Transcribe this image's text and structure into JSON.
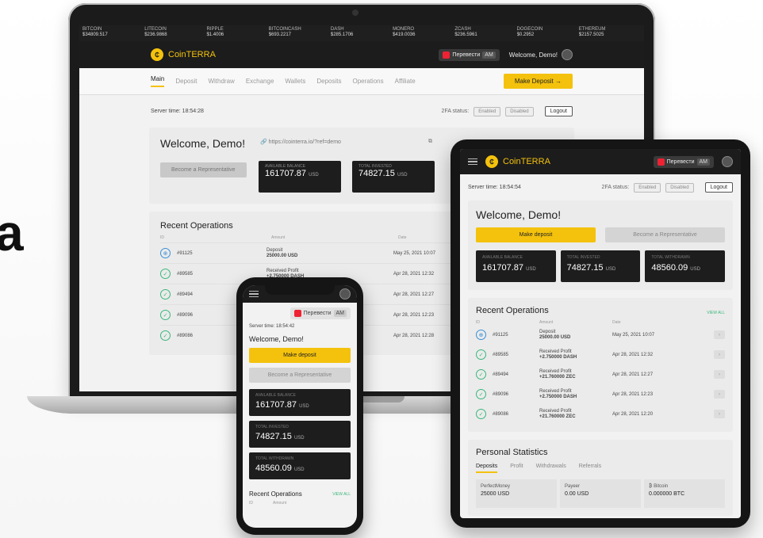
{
  "side_letter": "a",
  "laptop": {
    "ticker": [
      {
        "name": "BITCOIN",
        "value": "$34809.517"
      },
      {
        "name": "LITECOIN",
        "value": "$236.9868"
      },
      {
        "name": "RIPPLE",
        "value": "$1.4006"
      },
      {
        "name": "BITCOINCASH",
        "value": "$693.2217"
      },
      {
        "name": "DASH",
        "value": "$285.1706"
      },
      {
        "name": "MONERO",
        "value": "$419.0036"
      },
      {
        "name": "ZCASH",
        "value": "$236.5961"
      },
      {
        "name": "DOGECOIN",
        "value": "$0.2952"
      },
      {
        "name": "ETHEREUM",
        "value": "$2157.5025"
      }
    ],
    "brand": "CoinTERRA",
    "transfer_label": "Перевести",
    "currency": "AM",
    "welcome_top": "Welcome, Demo!",
    "nav": [
      "Main",
      "Deposit",
      "Withdraw",
      "Exchange",
      "Wallets",
      "Deposits",
      "Operations",
      "Affiliate"
    ],
    "make_deposit": "Make Deposit →",
    "server_time": "Server time: 18:54:28",
    "fa_status": "2FA status:",
    "fa_enabled": "Enabled",
    "fa_disabled": "Disabled",
    "logout": "Logout",
    "welcome": "Welcome, Demo!",
    "ref_link": "https://cointerra.io/?ref=demo",
    "rep_button": "Become a Representative",
    "balance_label": "AVAILABLE BALANCE",
    "balance_value": "161707.87",
    "invested_label": "TOTAL INVESTED",
    "invested_value": "74827.15",
    "unit": "USD",
    "recent_ops": "Recent Operations",
    "col_id": "ID",
    "col_amount": "Amount",
    "col_date": "Date",
    "ops": [
      {
        "id": "#91125",
        "type": "Deposit",
        "amount": "25000.00 USD",
        "date": "May 25, 2021 10:07",
        "icon": "blue"
      },
      {
        "id": "#89585",
        "type": "Received Profit",
        "amount": "+2.750000 DASH",
        "date": "Apr 28, 2021 12:32",
        "icon": "green"
      },
      {
        "id": "#89494",
        "type": "",
        "amount": "",
        "date": "Apr 28, 2021 12:27",
        "icon": "green"
      },
      {
        "id": "#89096",
        "type": "",
        "amount": "",
        "date": "Apr 28, 2021 12:23",
        "icon": "green"
      },
      {
        "id": "#89086",
        "type": "",
        "amount": "",
        "date": "Apr 28, 2021 12:28",
        "icon": "green"
      }
    ]
  },
  "tablet": {
    "brand": "CoinTERRA",
    "transfer_label": "Перевести",
    "currency": "AM",
    "server_time": "Server time: 18:54:54",
    "fa_status": "2FA status:",
    "fa_enabled": "Enabled",
    "fa_disabled": "Disabled",
    "logout": "Logout",
    "welcome": "Welcome, Demo!",
    "make_deposit": "Make deposit",
    "rep_button": "Become a Representative",
    "tiles": [
      {
        "label": "AVAILABLE BALANCE",
        "value": "161707.87",
        "unit": "USD"
      },
      {
        "label": "TOTAL INVESTED",
        "value": "74827.15",
        "unit": "USD"
      },
      {
        "label": "TOTAL WITHDRAWN",
        "value": "48560.09",
        "unit": "USD"
      }
    ],
    "recent_ops": "Recent Operations",
    "view_all": "VIEW ALL",
    "col_id": "ID",
    "col_amount": "Amount",
    "col_date": "Date",
    "ops": [
      {
        "id": "#91125",
        "type": "Deposit",
        "amount": "25000.00 USD",
        "date": "May 25, 2021 10:07",
        "icon": "blue"
      },
      {
        "id": "#89585",
        "type": "Received Profit",
        "amount": "+2.750000 DASH",
        "date": "Apr 28, 2021 12:32",
        "icon": "green"
      },
      {
        "id": "#89494",
        "type": "Received Profit",
        "amount": "+21.760000 ZEC",
        "date": "Apr 28, 2021 12:27",
        "icon": "green"
      },
      {
        "id": "#89096",
        "type": "Received Profit",
        "amount": "+2.750000 DASH",
        "date": "Apr 28, 2021 12:23",
        "icon": "green"
      },
      {
        "id": "#89086",
        "type": "Received Profit",
        "amount": "+21.760000 ZEC",
        "date": "Apr 28, 2021 12:20",
        "icon": "green"
      }
    ],
    "personal_stats": "Personal Statistics",
    "stat_tabs": [
      "Deposits",
      "Profit",
      "Withdrawals",
      "Referrals"
    ],
    "stat_cells": [
      {
        "name": "PerfectMoney",
        "value": "25000 USD"
      },
      {
        "name": "Payeer",
        "value": "0.00 USD"
      },
      {
        "name": "₿ Bitcoin",
        "value": "0.000000 BTC"
      }
    ]
  },
  "phone": {
    "transfer_label": "Перевести",
    "currency": "AM",
    "server_time": "Server time: 18:54:42",
    "welcome": "Welcome, Demo!",
    "make_deposit": "Make deposit",
    "rep_button": "Become a Representative",
    "tiles": [
      {
        "label": "AVAILABLE BALANCE",
        "value": "161707.87",
        "unit": "USD"
      },
      {
        "label": "TOTAL INVESTED",
        "value": "74827.15",
        "unit": "USD"
      },
      {
        "label": "TOTAL WITHDRAWN",
        "value": "48560.09",
        "unit": "USD"
      }
    ],
    "recent_ops": "Recent Operations",
    "view_all": "VIEW ALL",
    "col_id": "ID",
    "col_amount": "Amount"
  },
  "colors": {
    "accent": "#f4c20d",
    "dark": "#1c1c1c",
    "success": "#3ab77b",
    "info": "#3a8fd6"
  }
}
